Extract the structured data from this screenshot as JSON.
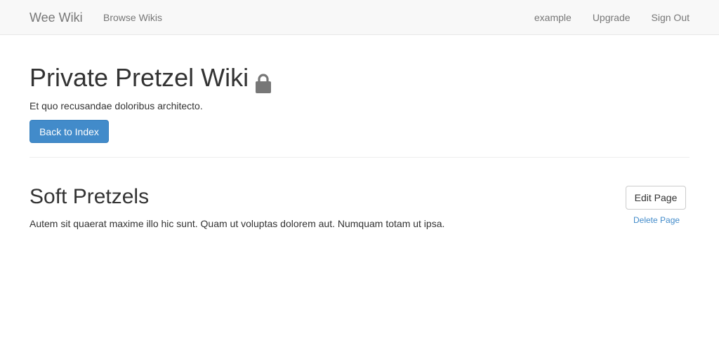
{
  "navbar": {
    "brand": "Wee Wiki",
    "browse": "Browse Wikis",
    "right_links": [
      "example",
      "Upgrade",
      "Sign Out"
    ]
  },
  "wiki": {
    "title": "Private Pretzel Wiki",
    "lock_icon": "lock-icon",
    "description": "Et quo recusandae doloribus architecto.",
    "back_button": "Back to Index"
  },
  "page": {
    "title": "Soft Pretzels",
    "body": "Autem sit quaerat maxime illo hic sunt. Quam ut voluptas dolorem aut. Numquam totam ut ipsa.",
    "edit_button": "Edit Page",
    "delete_link": "Delete Page"
  },
  "colors": {
    "primary": "#428bca",
    "navbar_bg": "#f8f8f8",
    "nav_text": "#777777",
    "text": "#333333"
  }
}
